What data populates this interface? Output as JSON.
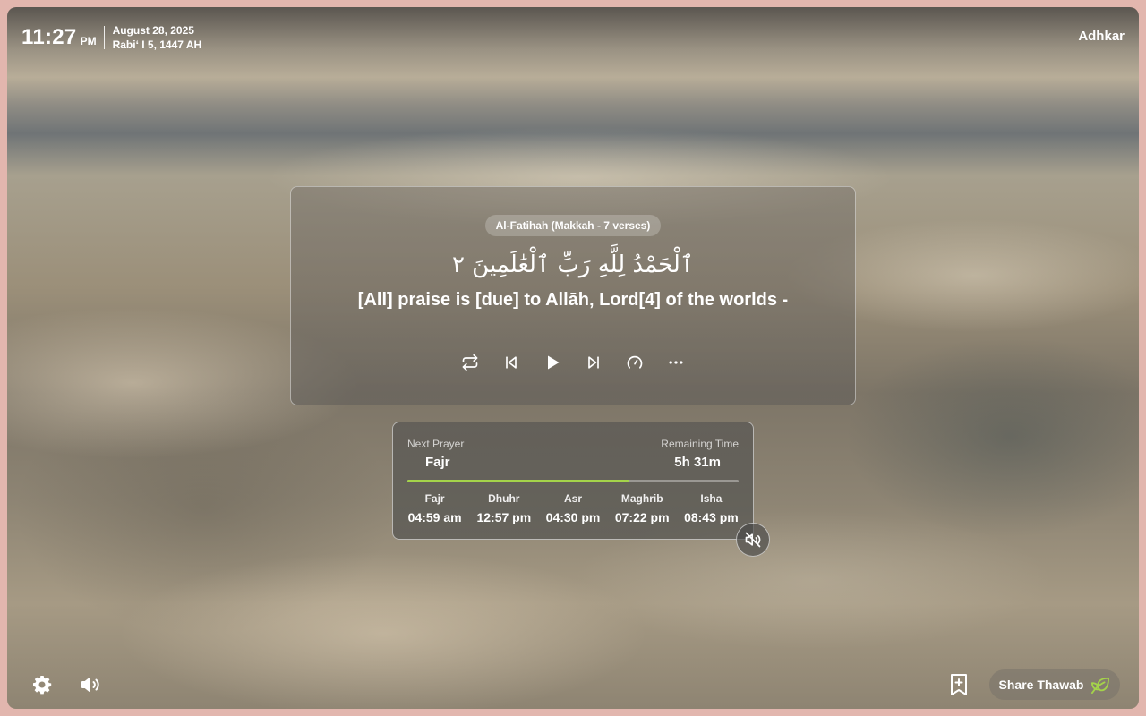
{
  "clock": {
    "time": "11:27",
    "ampm": "PM",
    "gregorian_date": "August 28, 2025",
    "hijri_date": "Rabiʻ I 5, 1447 AH"
  },
  "header": {
    "adhkar_label": "Adhkar"
  },
  "verse": {
    "surah_info": "Al-Fatihah (Makkah - 7 verses)",
    "arabic": "ٱلْحَمْدُ لِلَّهِ رَبِّ ٱلْعَٰلَمِينَ ٢",
    "translation": "[All] praise is [due] to Allāh, Lord[4] of the worlds -",
    "controls": [
      "repeat-icon",
      "previous-icon",
      "play-icon",
      "next-icon",
      "speed-icon",
      "more-icon"
    ]
  },
  "prayer": {
    "next_label": "Next Prayer",
    "next_name": "Fajr",
    "remaining_label": "Remaining Time",
    "remaining_value": "5h 31m",
    "progress_fraction": 0.67,
    "accent_color": "#a4d34a",
    "times": [
      {
        "name": "Fajr",
        "time": "04:59 am"
      },
      {
        "name": "Dhuhr",
        "time": "12:57 pm"
      },
      {
        "name": "Asr",
        "time": "04:30 pm"
      },
      {
        "name": "Maghrib",
        "time": "07:22 pm"
      },
      {
        "name": "Isha",
        "time": "08:43 pm"
      }
    ]
  },
  "footer": {
    "share_label": "Share Thawab",
    "icons": [
      "gear-icon",
      "speaker-icon",
      "bookmark-add-icon",
      "leaf-icon"
    ]
  }
}
